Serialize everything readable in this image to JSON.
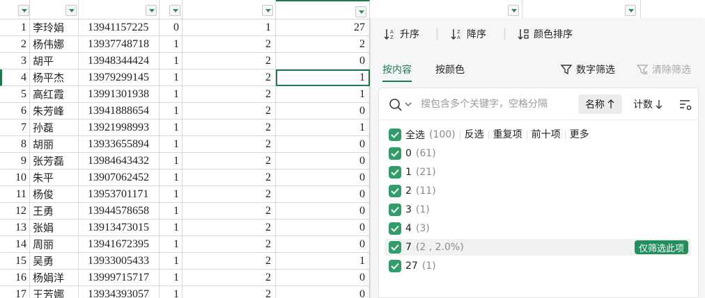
{
  "rows": [
    {
      "n": "1",
      "name": "李玲娟",
      "phone": "13941157225",
      "a": "0",
      "b": "1",
      "c": "27"
    },
    {
      "n": "2",
      "name": "杨伟娜",
      "phone": "13937748718",
      "a": "1",
      "b": "2",
      "c": "2"
    },
    {
      "n": "3",
      "name": "胡平",
      "phone": "13948344424",
      "a": "1",
      "b": "2",
      "c": "0"
    },
    {
      "n": "4",
      "name": "杨平杰",
      "phone": "13979299145",
      "a": "1",
      "b": "2",
      "c": "1"
    },
    {
      "n": "5",
      "name": "高红霞",
      "phone": "13991301938",
      "a": "1",
      "b": "2",
      "c": "1"
    },
    {
      "n": "6",
      "name": "朱芳峰",
      "phone": "13941888654",
      "a": "1",
      "b": "2",
      "c": "0"
    },
    {
      "n": "7",
      "name": "孙磊",
      "phone": "13921998993",
      "a": "1",
      "b": "2",
      "c": "1"
    },
    {
      "n": "8",
      "name": "胡丽",
      "phone": "13933655894",
      "a": "1",
      "b": "2",
      "c": "0"
    },
    {
      "n": "9",
      "name": "张芳磊",
      "phone": "13984643432",
      "a": "1",
      "b": "2",
      "c": "0"
    },
    {
      "n": "10",
      "name": "朱平",
      "phone": "13907062452",
      "a": "1",
      "b": "2",
      "c": "0"
    },
    {
      "n": "11",
      "name": "杨俊",
      "phone": "13953701171",
      "a": "1",
      "b": "2",
      "c": "0"
    },
    {
      "n": "12",
      "name": "王勇",
      "phone": "13944578658",
      "a": "1",
      "b": "2",
      "c": "0"
    },
    {
      "n": "13",
      "name": "张娟",
      "phone": "13913473015",
      "a": "1",
      "b": "2",
      "c": "0"
    },
    {
      "n": "14",
      "name": "周丽",
      "phone": "13941672395",
      "a": "1",
      "b": "2",
      "c": "0"
    },
    {
      "n": "15",
      "name": "吴勇",
      "phone": "13933005433",
      "a": "1",
      "b": "2",
      "c": "1"
    },
    {
      "n": "16",
      "name": "杨娟洋",
      "phone": "13999715717",
      "a": "1",
      "b": "2",
      "c": "0"
    },
    {
      "n": "17",
      "name": "王芳娜",
      "phone": "13934393057",
      "a": "1",
      "b": "2",
      "c": "0"
    }
  ],
  "active_row": 4,
  "sort": {
    "asc": "升序",
    "desc": "降序",
    "color": "颜色排序"
  },
  "tabs": {
    "content": "按内容",
    "color": "按颜色",
    "number_filter": "数字筛选",
    "clear_filter": "清除筛选"
  },
  "search": {
    "placeholder": "搜包含多个关键字，空格分隔",
    "value": ""
  },
  "list_sort": {
    "name": "名称",
    "count": "计数"
  },
  "select_all": {
    "label": "全选",
    "count": "(100)",
    "actions": [
      "反选",
      "重复项",
      "前十项",
      "更多"
    ]
  },
  "items": [
    {
      "label": "0",
      "count": "(61)"
    },
    {
      "label": "1",
      "count": "(21)"
    },
    {
      "label": "2",
      "count": "(11)"
    },
    {
      "label": "3",
      "count": "(1)"
    },
    {
      "label": "4",
      "count": "(3)"
    },
    {
      "label": "7",
      "count": "(2 , 2.0%)"
    },
    {
      "label": "27",
      "count": "(1)"
    }
  ],
  "only_this": "仅筛选此项",
  "colors": {
    "accent": "#1e7a4a",
    "check": "#2f9e6a"
  }
}
